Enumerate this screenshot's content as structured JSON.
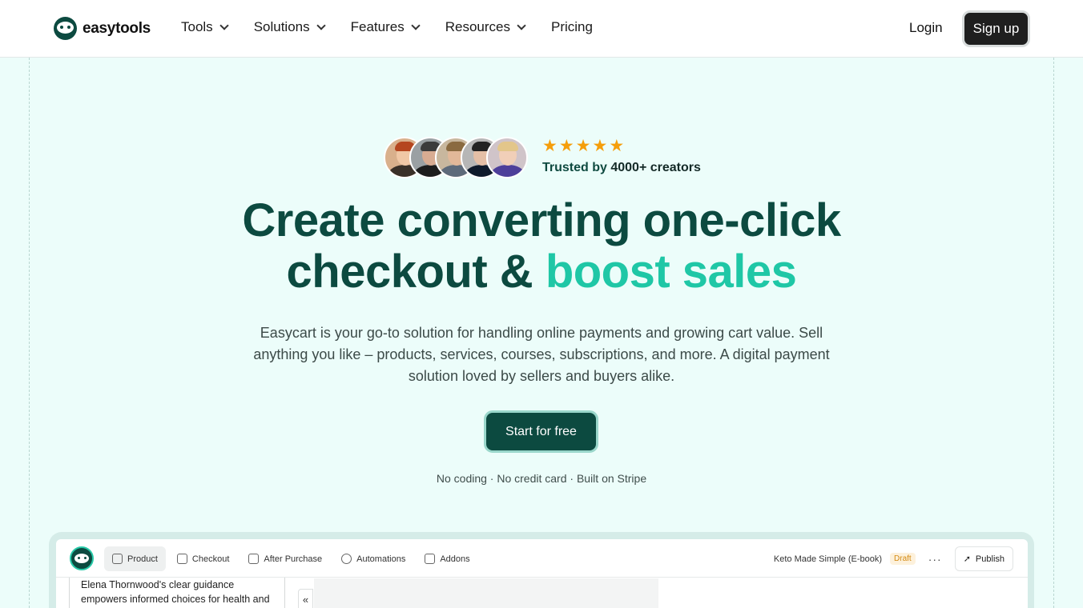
{
  "nav": {
    "logo_text": "easytools",
    "items": [
      {
        "label": "Tools",
        "has_dropdown": true
      },
      {
        "label": "Solutions",
        "has_dropdown": true
      },
      {
        "label": "Features",
        "has_dropdown": true
      },
      {
        "label": "Resources",
        "has_dropdown": true
      },
      {
        "label": "Pricing",
        "has_dropdown": false
      }
    ],
    "login_label": "Login",
    "signup_label": "Sign up"
  },
  "hero": {
    "rating_stars": 5,
    "star_glyph": "★",
    "trusted_prefix": "Trusted by",
    "trusted_count": "4000+ creators",
    "headline_line1": "Create converting one-click",
    "headline_line2_start": "checkout &",
    "headline_accent": "boost sales",
    "subtitle": "Easycart is your go-to solution for handling online payments and growing cart value. Sell anything you like – products, services, courses, subscriptions, and more. A digital payment solution loved by sellers and buyers alike.",
    "cta_label": "Start for free",
    "note": "No coding · No credit card · Built on Stripe"
  },
  "app_preview": {
    "tabs": [
      {
        "label": "Product",
        "active": true
      },
      {
        "label": "Checkout",
        "active": false
      },
      {
        "label": "After Purchase",
        "active": false
      },
      {
        "label": "Automations",
        "active": false
      },
      {
        "label": "Addons",
        "active": false
      }
    ],
    "product_name": "Keto Made Simple (E-book)",
    "status_badge": "Draft",
    "more_label": "···",
    "publish_label": "Publish",
    "collapse_label": "«",
    "description_line1": "Elena Thornwood's clear guidance",
    "description_line2": "empowers informed choices for health and"
  },
  "colors": {
    "brand_dark": "#0c4a40",
    "brand_accent": "#1fc7a6",
    "hero_bg": "#ecfdfa",
    "star": "#f59e0b"
  }
}
